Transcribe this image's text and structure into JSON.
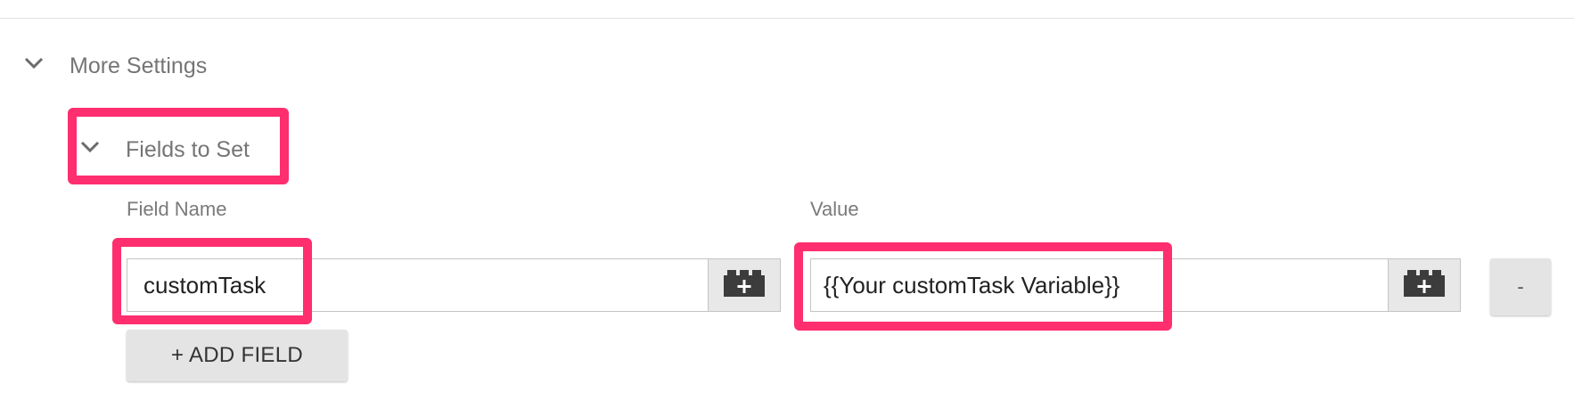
{
  "more_settings": {
    "title": "More Settings",
    "expand_icon": "chevron-down-icon"
  },
  "fields_to_set": {
    "title": "Fields to Set",
    "expand_icon": "chevron-down-icon",
    "columns": {
      "field_name_label": "Field Name",
      "value_label": "Value"
    },
    "rows": [
      {
        "field_name": "customTask",
        "value": "{{Your customTask Variable}}",
        "field_name_variable_icon": "variable-brick-icon",
        "value_variable_icon": "variable-brick-icon",
        "remove_label": "-"
      }
    ],
    "add_field_label": "+ ADD FIELD"
  },
  "annotations": {
    "highlight_color": "#ff2e6e"
  }
}
